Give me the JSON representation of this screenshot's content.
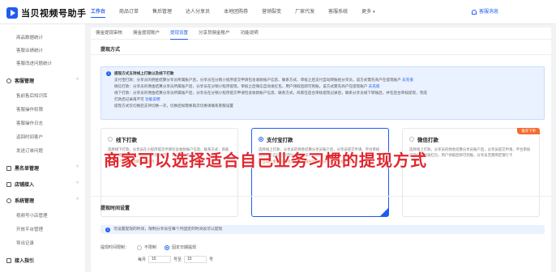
{
  "app": {
    "title": "当贝视频号助手"
  },
  "topnav": {
    "items": [
      "工作台",
      "商品订单",
      "售后管理",
      "达人分享员",
      "本地团购券",
      "营销裂变",
      "厂家代发",
      "客服系统",
      "更多"
    ],
    "service_label": "客服消息"
  },
  "sidebar": {
    "sub_top": [
      "商品数据统计",
      "客服业绩统计",
      "客服改进问题统计"
    ],
    "groups": [
      {
        "label": "客服管理",
        "items": [
          "售前售后知识库",
          "客服操作权限",
          "客服操作日志",
          "返回时间客户",
          "发送订单问题"
        ]
      },
      {
        "label": "黑名单管理",
        "items": []
      },
      {
        "label": "店铺接入",
        "items": []
      },
      {
        "label": "系统管理",
        "items": [
          "视频号小店管理",
          "开放平台管理",
          "导出记录"
        ]
      },
      {
        "label": "接入指引",
        "items": []
      }
    ]
  },
  "subtabs": [
    "佣金提现审核",
    "佣金提现账户",
    "提现设置",
    "分享员佣金账户",
    "功能说明"
  ],
  "withdraw_section": {
    "title": "提现方式",
    "notice": [
      "提现方式支持线上打款以及线下打款",
      "支付宝打款：分享员的佣金结算分享员所属账户后，分享员在分销小程序提交申请包含收款账户信息、联系方式、审核之后支付自动转账给分享员，该方式需先商户在提现账户 去充值",
      "微信打款：分享员的佣金结算分享员所属账户后，分享员在分销小程序提现，审核之后微信自动发红包，用户领取后即可到账，该方式需先商户在提现账户 去充值",
      "线下打款：分享员的佣金结算分享员所属账户后，分享员在分销小程序提交申请包含收款账户信息、联系方式，商家在后台审核提现记录后，联系分享员线下转账后，并在后台审核提现，完成",
      "打款后记录再不可 功能说明",
      "提现方式仅切换后支持切换一次，切换后如需要再次切换请联系客服设置"
    ],
    "cards": [
      {
        "title": "线下打款",
        "desc": "选择线下打款，分享员在小程序提交申请包含收款账户信息、联系方式，商家在后台审核通过后，线下与分享员打款，并在后台审核",
        "note": "适合商户金额较大的商家使用",
        "badge": "",
        "selected": false
      },
      {
        "title": "支付宝打款",
        "desc": "选择线上打款，分享员的佣金结算分享员账户后，分享员提交申请，平台审核后支付宝自动打款到分享员的支付宝账户",
        "note": "适合商户金额较大且分享员大部分为外部分享员的商家使用",
        "badge": "",
        "selected": true
      },
      {
        "title": "微信打款",
        "desc": "选择线上打款，分享员的佣金结算分享员账户后，分享员提交申请，平台审核后微信自动发红包，用户领取后即可到账，分享员无需绑定银行卡",
        "note": "",
        "badge": "推荐下单",
        "selected": false
      }
    ]
  },
  "overlay_caption": "商家可以选择适合自己业务习惯的提现方式",
  "time_section": {
    "title": "提现时间设置",
    "notice": "可设置提现的时间，限制分享员在每个月固定的时间段可以提现",
    "row_label": "提现时间限制：",
    "options": [
      "不限制",
      "固定日期提现"
    ],
    "selected_option": 1,
    "month_label": "每月",
    "from_day": "15",
    "to_label": "号至",
    "to_day": "15",
    "unit": "号"
  },
  "colors": {
    "accent": "#1e5cf0",
    "overlay": "#e0272f",
    "badge": "#f56c2d",
    "note": "#e3612d"
  }
}
